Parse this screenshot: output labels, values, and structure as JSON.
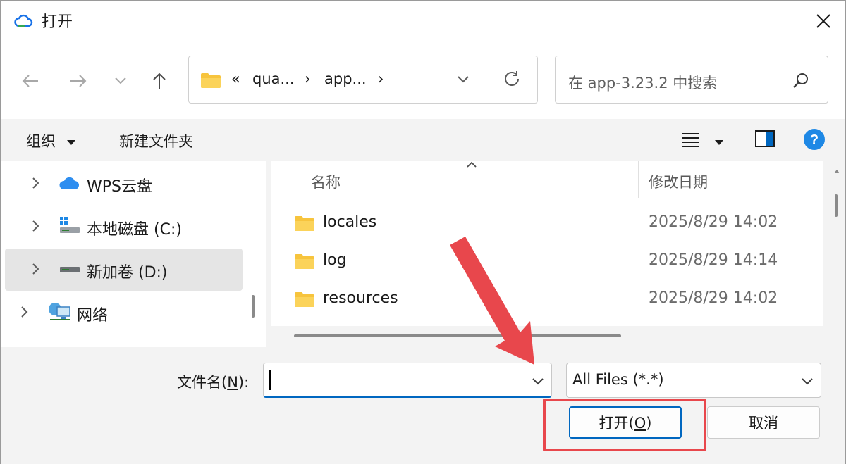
{
  "window": {
    "title": "打开",
    "close_glyph": "✕"
  },
  "nav": {
    "back_glyph": "←",
    "forward_glyph": "→",
    "recent_glyph": "⌄",
    "up_glyph": "↑",
    "breadcrumb_overflow": "«",
    "breadcrumb": [
      "qua...",
      "app..."
    ],
    "separator": "›",
    "dropdown_glyph": "⌄",
    "refresh_glyph": "↻"
  },
  "search": {
    "placeholder": "在 app-3.23.2 中搜索",
    "icon": "search-icon"
  },
  "commands": {
    "organize": "组织",
    "new_folder": "新建文件夹",
    "view_menu_glyph": "≡",
    "help_glyph": "?"
  },
  "tree": [
    {
      "label": "WPS云盘",
      "icon": "cloud-icon",
      "selected": false
    },
    {
      "label": "本地磁盘 (C:)",
      "icon": "drive-c-icon",
      "selected": false
    },
    {
      "label": "新加卷 (D:)",
      "icon": "drive-d-icon",
      "selected": true
    },
    {
      "label": "网络",
      "icon": "network-icon",
      "selected": false
    }
  ],
  "columns": {
    "name": "名称",
    "modified": "修改日期"
  },
  "files": [
    {
      "name": "locales",
      "date": "2025/8/29 14:02"
    },
    {
      "name": "log",
      "date": "2025/8/29 14:14"
    },
    {
      "name": "resources",
      "date": "2025/8/29 14:02"
    }
  ],
  "bottom": {
    "filename_label_prefix": "文件名(",
    "filename_label_key": "N",
    "filename_label_suffix": "):",
    "filename_value": "",
    "file_type": "All Files (*.*)",
    "open_prefix": "打开(",
    "open_key": "O",
    "open_suffix": ")",
    "cancel": "取消"
  },
  "colors": {
    "accent": "#0067c0",
    "annotation": "#e8474c",
    "folder": "#f7c43d"
  }
}
